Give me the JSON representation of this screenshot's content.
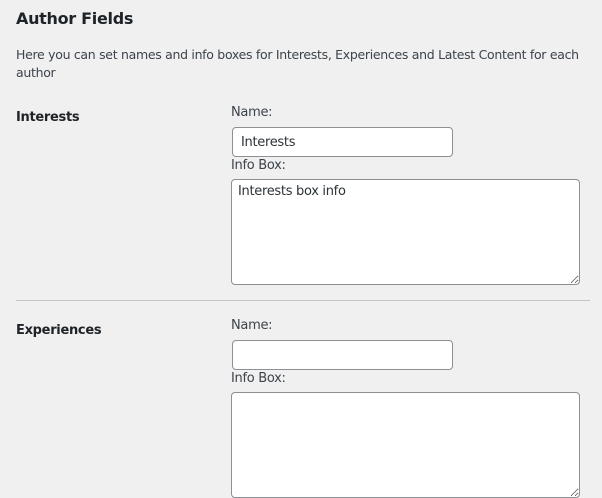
{
  "title": "Author Fields",
  "description": "Here you can set names and info boxes for Interests, Experiences and Latest Content for each author",
  "sections": [
    {
      "heading": "Interests",
      "name_label": "Name:",
      "name_value": "Interests",
      "info_label": "Info Box:",
      "info_value": "Interests box info"
    },
    {
      "heading": "Experiences",
      "name_label": "Name:",
      "name_value": "",
      "info_label": "Info Box:",
      "info_value": ""
    }
  ]
}
